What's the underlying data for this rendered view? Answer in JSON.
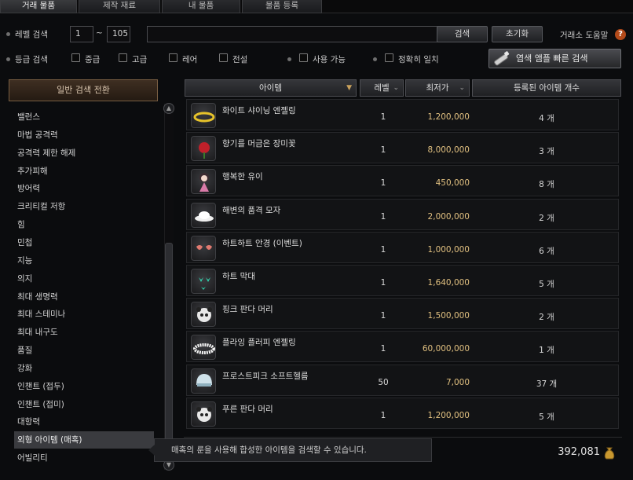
{
  "tabs": [
    "거래 물품",
    "제작 재료",
    "내 물품",
    "물품 등록"
  ],
  "filters": {
    "level_label": "레벨 검색",
    "level_min": "1",
    "level_sep": "~",
    "level_max": "105",
    "search_text": "",
    "search_button": "검색",
    "reset_button": "초기화",
    "help_label": "거래소 도움말",
    "help_icon": "?",
    "grade_label": "등급 검색",
    "grades": [
      "중급",
      "고급",
      "레어",
      "전설"
    ],
    "usable_label": "사용 가능",
    "exact_label": "정확히 일치",
    "quick_search_button": "염색 앰플 빠른 검색"
  },
  "left_panel": {
    "mode_button": "일반 검색 전환",
    "categories": [
      "밸런스",
      "마법 공격력",
      "공격력 제한 해제",
      "추가피해",
      "방어력",
      "크리티컬 저항",
      "힘",
      "민첩",
      "지능",
      "의지",
      "최대 생명력",
      "최대 스테미나",
      "최대 내구도",
      "품질",
      "강화",
      "인챈트 (접두)",
      "인챈트 (접미)",
      "대항력",
      "외형 아이템 (매혹)",
      "어빌리티"
    ],
    "selected_index": 18
  },
  "table": {
    "headers": {
      "item": "아이템",
      "level": "레벨",
      "price": "최저가",
      "count": "등록된 아이템 개수"
    },
    "rows": [
      {
        "name": "화이트 샤이닝 엔젤링",
        "level": "1",
        "price": "1,200,000",
        "count": "4 개",
        "icon": "halo-icon"
      },
      {
        "name": "향기를 머금은 장미꽃",
        "level": "1",
        "price": "8,000,000",
        "count": "3 개",
        "icon": "rose-icon"
      },
      {
        "name": "행복한 유이",
        "level": "1",
        "price": "450,000",
        "count": "8 개",
        "icon": "doll-icon"
      },
      {
        "name": "해변의 품격 모자",
        "level": "1",
        "price": "2,000,000",
        "count": "2 개",
        "icon": "hat-icon"
      },
      {
        "name": "하트하트 안경 (이벤트)",
        "level": "1",
        "price": "1,000,000",
        "count": "6 개",
        "icon": "glasses-icon"
      },
      {
        "name": "하트 막대",
        "level": "1",
        "price": "1,640,000",
        "count": "5 개",
        "icon": "heart-stick-icon"
      },
      {
        "name": "핑크 판다 머리",
        "level": "1",
        "price": "1,500,000",
        "count": "2 개",
        "icon": "panda-head-icon"
      },
      {
        "name": "플라잉 플러피 엔젤링",
        "level": "1",
        "price": "60,000,000",
        "count": "1 개",
        "icon": "fluffy-halo-icon"
      },
      {
        "name": "프로스트피크 소프트헬름",
        "level": "50",
        "price": "7,000",
        "count": "37 개",
        "icon": "helm-icon"
      },
      {
        "name": "푸른 판다 머리",
        "level": "1",
        "price": "1,200,000",
        "count": "5 개",
        "icon": "panda-head-icon"
      }
    ]
  },
  "tooltip": "매혹의 룬을 사용해 합성한 아이템을 검색할 수 있습니다.",
  "gold": "392,081",
  "colors": {
    "price": "#e1c080",
    "accent": "#c9a15c",
    "panel": "#121315"
  }
}
